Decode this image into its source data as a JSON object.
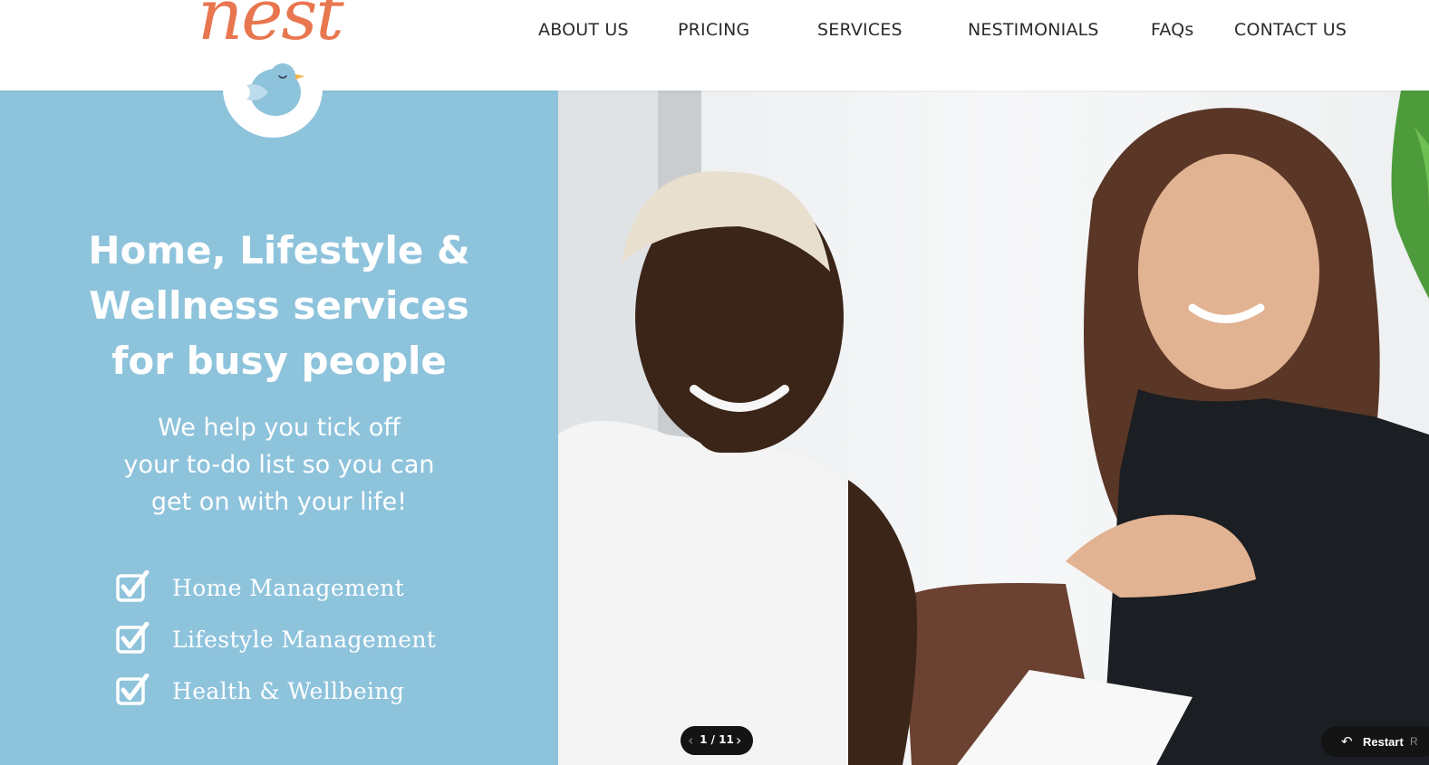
{
  "brand": {
    "name": "nest"
  },
  "nav": {
    "items": [
      {
        "label": "ABOUT US"
      },
      {
        "label": "PRICING"
      },
      {
        "label": "SERVICES"
      },
      {
        "label": "NESTIMONIALS"
      },
      {
        "label": "FAQs"
      },
      {
        "label": "CONTACT US"
      }
    ]
  },
  "hero": {
    "headline": [
      "Home, Lifestyle &",
      "Wellness services",
      "for busy people"
    ],
    "subheadline": [
      "We help you tick off",
      "your to-do list so you can",
      "get on with your life!"
    ],
    "services": [
      {
        "label": "Home Management",
        "icon": "checkbox-checked-icon"
      },
      {
        "label": "Lifestyle Management",
        "icon": "checkbox-checked-icon"
      },
      {
        "label": "Health & Wellbeing",
        "icon": "checkbox-checked-icon"
      }
    ],
    "image": {
      "subject": "two women smiling"
    }
  },
  "slideshow": {
    "counter": "1 / 11",
    "prev_icon": "chevron-left-icon",
    "next_icon": "chevron-right-icon"
  },
  "restart": {
    "label": "Restart",
    "shortcut": "R",
    "icon": "undo-arrow-icon"
  },
  "colors": {
    "brand_orange": "#e8764f",
    "panel_blue": "#8ec3dc",
    "text_dark": "#2b2b2b",
    "pill_black": "#141414"
  }
}
